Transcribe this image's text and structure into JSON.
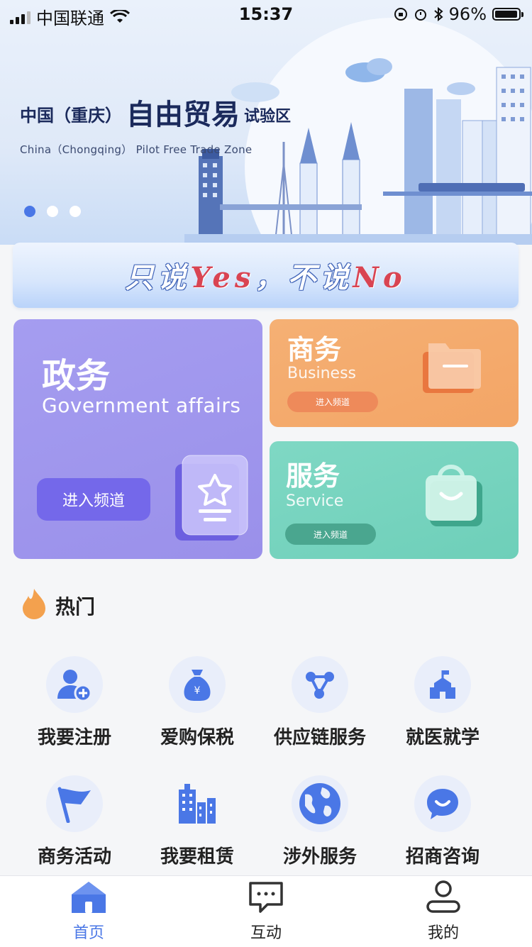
{
  "status_bar": {
    "carrier": "中国联通",
    "time": "15:37",
    "battery": "96%",
    "battery_level": 0.96
  },
  "banner": {
    "title_prefix": "中国（重庆）",
    "title_main": "自由贸易",
    "title_suffix": "试验区",
    "subtitle": "China（Chongqing） Pilot Free Trade Zone",
    "dots": 3,
    "active_dot": 0
  },
  "slogan": {
    "part1": "只说",
    "part2": "Yes",
    "comma": "，",
    "part3": "不说",
    "part4": "No"
  },
  "cards": {
    "gov": {
      "title": "政务",
      "subtitle": "Government affairs",
      "button": "进入频道",
      "icon": "badge-star-icon"
    },
    "biz": {
      "title": "商务",
      "subtitle": "Business",
      "button": "进入频道",
      "icon": "folder-icon"
    },
    "svc": {
      "title": "服务",
      "subtitle": "Service",
      "button": "进入频道",
      "icon": "shopping-bag-icon"
    }
  },
  "hot": {
    "title": "热门",
    "items": [
      {
        "label": "我要注册",
        "icon": "user-add-icon"
      },
      {
        "label": "爱购保税",
        "icon": "money-bag-icon"
      },
      {
        "label": "供应链服务",
        "icon": "network-icon"
      },
      {
        "label": "就医就学",
        "icon": "school-icon"
      },
      {
        "label": "商务活动",
        "icon": "flag-icon"
      },
      {
        "label": "我要租赁",
        "icon": "buildings-icon"
      },
      {
        "label": "涉外服务",
        "icon": "globe-icon"
      },
      {
        "label": "招商咨询",
        "icon": "chat-icon"
      }
    ]
  },
  "tabs": [
    {
      "label": "首页",
      "icon": "home-icon",
      "active": true
    },
    {
      "label": "互动",
      "icon": "message-icon",
      "active": false
    },
    {
      "label": "我的",
      "icon": "profile-icon",
      "active": false
    }
  ],
  "colors": {
    "accent": "#4a77e6",
    "gov_card": "#9a90ea",
    "biz_card": "#f3a566",
    "svc_card": "#6ecfb9",
    "icon_blue": "#4a77e6"
  }
}
